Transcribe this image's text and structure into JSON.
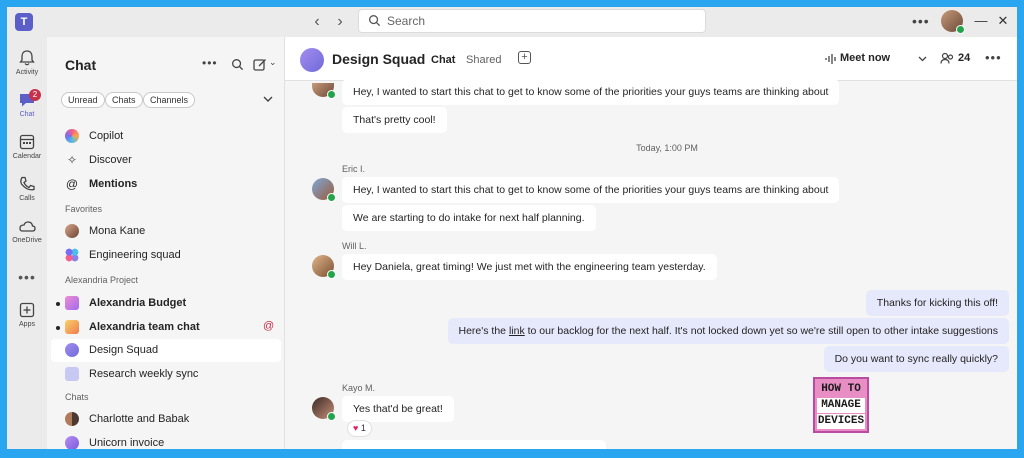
{
  "app": {
    "logo_letter": "T"
  },
  "titlebar": {
    "search_placeholder": "Search",
    "more_glyph": "•••",
    "minimize_glyph": "—",
    "close_glyph": "✕"
  },
  "rail": {
    "items": [
      {
        "label": "Activity"
      },
      {
        "label": "Chat",
        "badge": "2"
      },
      {
        "label": "Calendar"
      },
      {
        "label": "Calls"
      },
      {
        "label": "OneDrive"
      },
      {
        "label": "Apps"
      }
    ]
  },
  "chatlist": {
    "title": "Chat",
    "filters": [
      "Unread",
      "Chats",
      "Channels"
    ],
    "top_items": [
      {
        "label": "Copilot"
      },
      {
        "label": "Discover"
      },
      {
        "label": "Mentions"
      }
    ],
    "sections": [
      "Favorites",
      "Alexandria Project",
      "Chats"
    ],
    "favorites": [
      {
        "label": "Mona Kane"
      },
      {
        "label": "Engineering squad"
      }
    ],
    "project": [
      {
        "label": "Alexandria Budget"
      },
      {
        "label": "Alexandria team chat",
        "mention": "@"
      },
      {
        "label": "Design Squad"
      },
      {
        "label": "Research weekly sync"
      }
    ],
    "chats": [
      {
        "label": "Charlotte and Babak"
      },
      {
        "label": "Unicorn invoice"
      }
    ]
  },
  "header": {
    "name": "Design Squad",
    "tabs": [
      "Chat",
      "Shared"
    ],
    "meet_label": "Meet now",
    "participants": "24"
  },
  "messages": {
    "m1": "Hey, I wanted to start this chat to get to know some of the priorities your guys teams are thinking about",
    "m2": "That's pretty cool!",
    "timestamp": "Today, 1:00 PM",
    "eric_name": "Eric I.",
    "m3": "Hey, I wanted to start this chat to get to know some of the priorities your guys teams are thinking about",
    "m4": "We are starting to do intake for next half planning.",
    "will_name": "Will L.",
    "m5": "Hey Daniela, great timing! We just met with the engineering team yesterday.",
    "me1": "Thanks for kicking this off!",
    "me2_pre": "Here's the ",
    "me2_link": "link",
    "me2_post": " to our backlog for the next half. It's not locked down yet so we're still open to other intake suggestions",
    "me3": "Do you want to sync really quickly?",
    "kayo_name": "Kayo M.",
    "m6": "Yes that'd be great!",
    "reaction_count": "1"
  },
  "watermark": {
    "line1": "HOW TO",
    "line2": "MANAGE",
    "line3": "DEVICES"
  },
  "colors": {
    "accent": "#5b5fc7",
    "frame": "#2aa6f0",
    "presence": "#22a54a",
    "alert": "#c4314b"
  }
}
